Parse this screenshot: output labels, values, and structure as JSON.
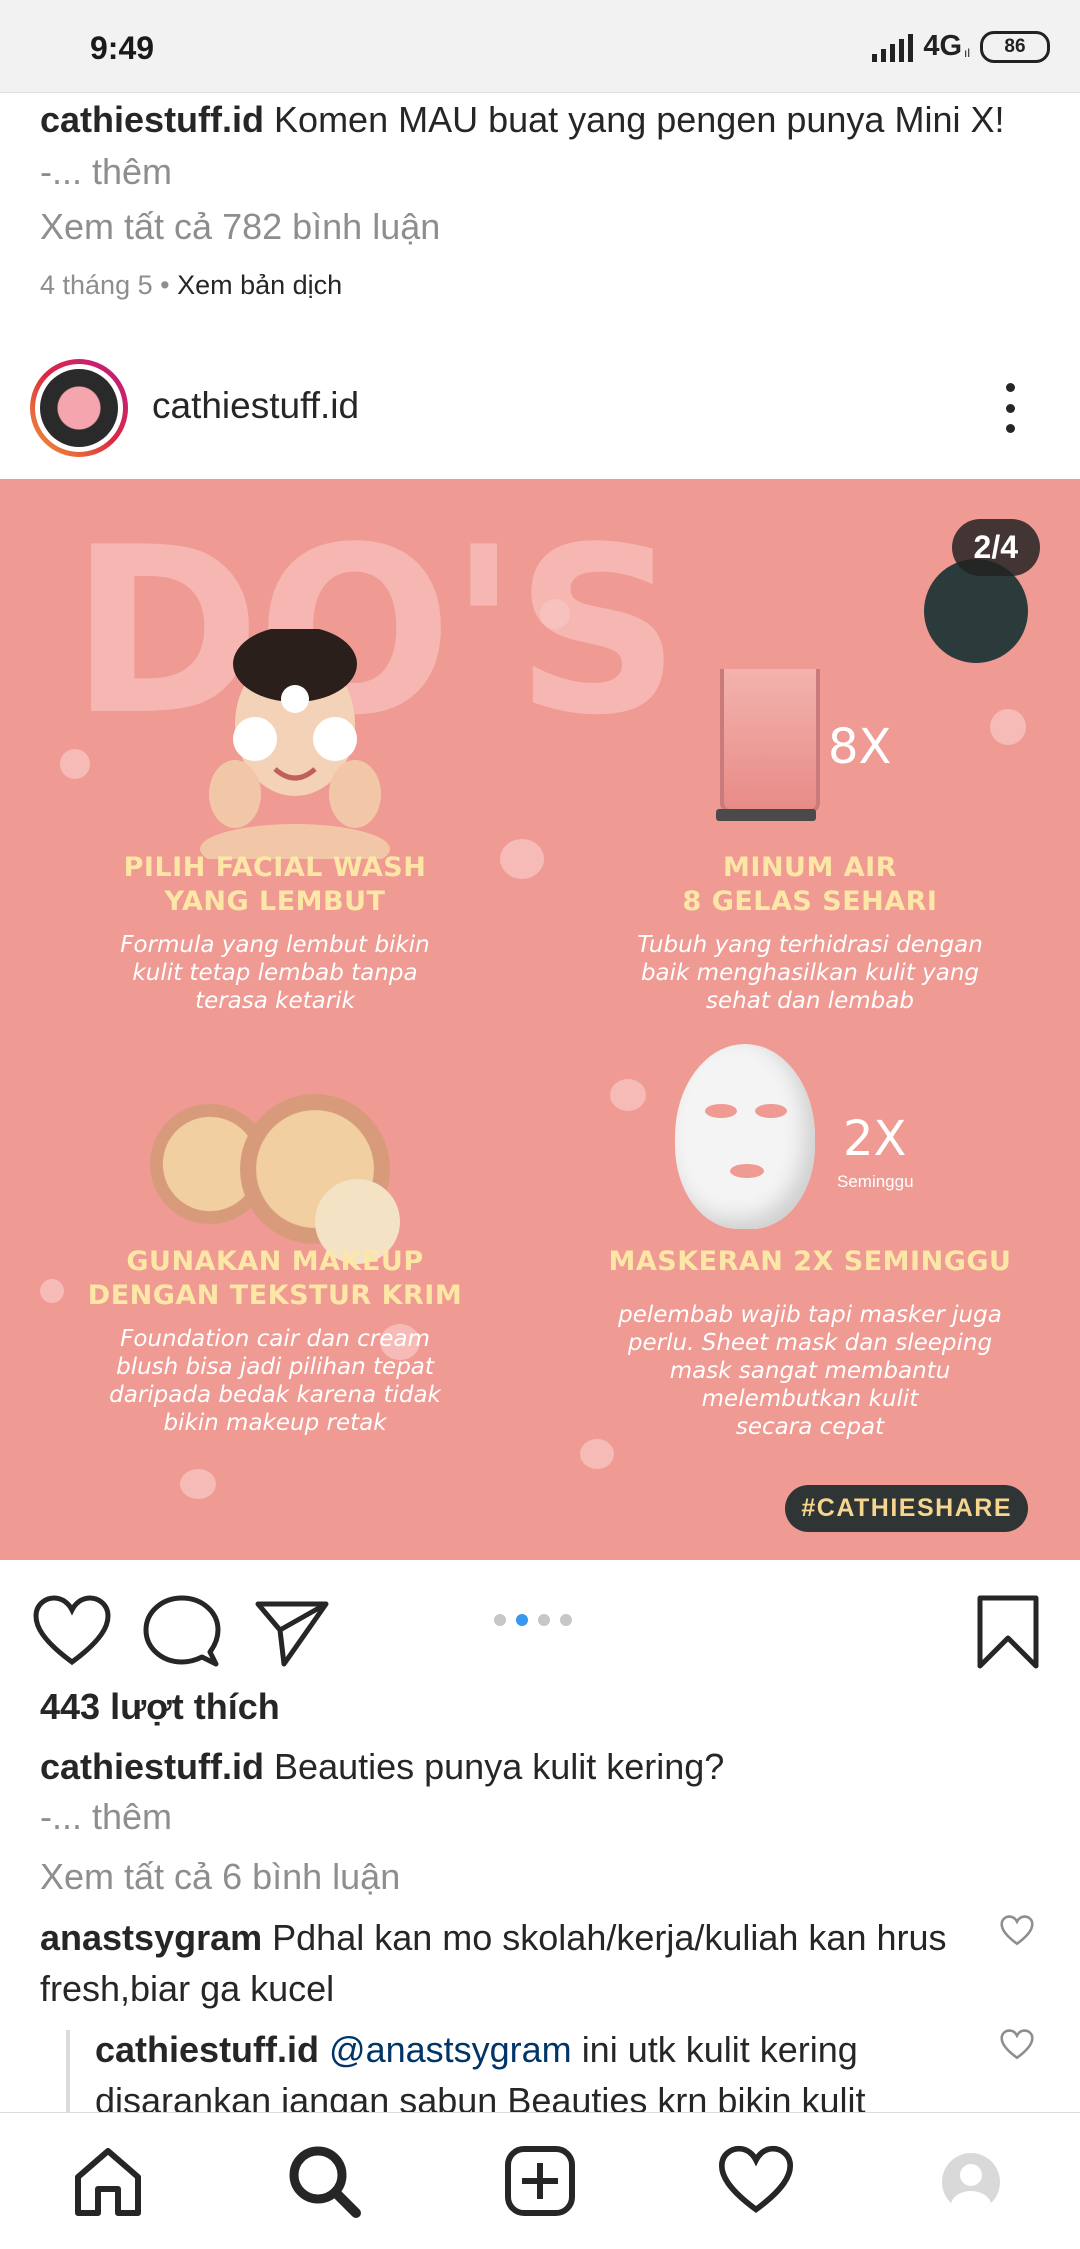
{
  "status_bar": {
    "time": "9:49",
    "network": "4G",
    "network_sub": "ıl",
    "battery": "86"
  },
  "prev_post": {
    "username": "cathiestuff.id",
    "caption": "Komen MAU buat yang pengen punya Mini X!",
    "more": "-... thêm",
    "view_comments": "Xem tất cả 782 bình luận",
    "date": "4 tháng 5",
    "separator": " • ",
    "translate": "Xem bản dịch"
  },
  "post": {
    "username": "cathiestuff.id",
    "image": {
      "headline": "DO'S",
      "counter": "2/4",
      "hashtag": "#CATHIESHARE",
      "cells": [
        {
          "title_1": "PILIH FACIAL WASH",
          "title_2": "YANG LEMBUT",
          "desc": [
            "Formula yang lembut bikin",
            "kulit tetap lembab tanpa",
            "terasa ketarik"
          ]
        },
        {
          "title_1": "MINUM AIR",
          "title_2": "8 GELAS SEHARI",
          "desc": [
            "Tubuh yang terhidrasi dengan",
            "baik menghasilkan kulit yang",
            "sehat dan lembab"
          ],
          "multiplier": "8X"
        },
        {
          "title_1": "GUNAKAN MAKEUP",
          "title_2": "DENGAN TEKSTUR KRIM",
          "desc": [
            "Foundation cair dan cream",
            "blush bisa jadi pilihan tepat",
            "daripada bedak karena tidak",
            "bikin makeup retak"
          ]
        },
        {
          "title_1": "MASKERAN 2X SEMINGGU",
          "title_2": "",
          "desc": [
            "pelembab wajib tapi masker juga",
            "perlu. Sheet mask dan sleeping",
            "mask sangat membantu",
            "melembutkan kulit",
            "secara cepat"
          ],
          "multiplier": "2X",
          "multiplier_sub": "Seminggu"
        }
      ]
    },
    "carousel": {
      "count": 4,
      "active_index": 1
    },
    "likes": "443 lượt thích",
    "caption": "Beauties punya kulit kering?",
    "more": "-... thêm",
    "view_comments": "Xem tất cả 6 bình luận",
    "comments": [
      {
        "username": "anastsygram",
        "text": "Pdhal kan mo skolah/kerja/kuliah kan hrus fresh,biar ga kucel"
      }
    ],
    "reply": {
      "username": "cathiestuff.id",
      "mention": "@anastsygram",
      "text": "ini utk kulit kering disarankan jangan sabun Beauties krn bikin kulit"
    }
  },
  "icons": {
    "like": "heart-icon",
    "comment": "comment-icon",
    "share": "send-icon",
    "save": "bookmark-icon",
    "home": "home-icon",
    "search": "search-icon",
    "add": "add-post-icon",
    "activity": "heart-icon",
    "profile": "avatar"
  },
  "colors": {
    "post_bg": "#ef9a93",
    "title_yellow": "#fde7a7",
    "hashtag_bg": "#2f3434",
    "accent_blue": "#3897f0",
    "mention": "#003569"
  }
}
